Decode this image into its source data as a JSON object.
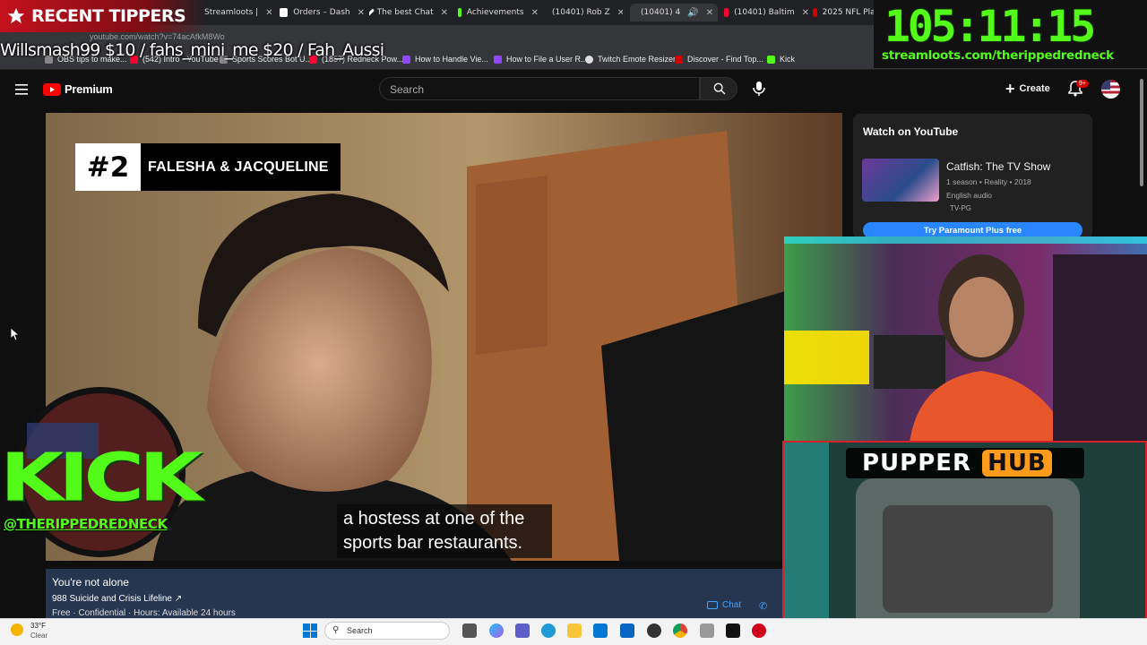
{
  "overlay": {
    "tippers_title": "RECENT TIPPERS",
    "tippers_scroll": "Willsmash99 $10 / fahs_mini_me $20 / Fah_Aussi",
    "timer": "105:11:15",
    "timer_url": "streamloots.com/therippedredneck",
    "kick_word": "KICK",
    "kick_handle": "@THERIPPEDREDNECK",
    "pupper_word": "PUPPER",
    "pupper_hub": "HUB"
  },
  "browser": {
    "tabs": [
      {
        "label": "Streamloots |",
        "color": "#ffffff"
      },
      {
        "label": "Orders – Dash",
        "color": "#ffffff"
      },
      {
        "label": "The best Chat",
        "color": "#ffffff"
      },
      {
        "label": "Achievements",
        "color": "#53fc18"
      },
      {
        "label": "(10401) Rob Z",
        "color": "#ff0033"
      },
      {
        "label": "(10401) 4",
        "color": "#ff0033"
      },
      {
        "label": "(10401) Baltim",
        "color": "#ff0033"
      },
      {
        "label": "2025 NFL Play",
        "color": "#d00000"
      }
    ],
    "url": "youtube.com/watch?v=74acAfkM8Wo",
    "bookmarks": [
      {
        "label": "OBS tips to make...",
        "color": "#888888"
      },
      {
        "label": "(542) Intro - YouTube",
        "color": "#ff0033"
      },
      {
        "label": "Sports Scores Bot U...",
        "color": "#888888"
      },
      {
        "label": "(1857) Redneck Pow...",
        "color": "#ff0033"
      },
      {
        "label": "How to Handle Vie...",
        "color": "#9146ff"
      },
      {
        "label": "How to File a User R...",
        "color": "#9146ff"
      },
      {
        "label": "Twitch Emote Resizer",
        "color": "#dddddd"
      },
      {
        "label": "Discover - Find Top...",
        "color": "#d00000"
      },
      {
        "label": "Kick",
        "color": "#53fc18"
      }
    ]
  },
  "youtube": {
    "brand": "Premium",
    "search_placeholder": "Search",
    "create_label": "Create",
    "notif_count": "9+",
    "video": {
      "rank": "#2",
      "rank_names": "FALESHA & JACQUELINE",
      "caption_line1": "a hostess at one of the",
      "caption_line2": "sports bar restaurants."
    },
    "crisis": {
      "title": "You're not alone",
      "line": "988 Suicide and Crisis Lifeline ↗",
      "sub": "Free · Confidential · Hours: Available 24 hours",
      "chat": "Chat"
    },
    "side": {
      "heading": "Watch on YouTube",
      "show_title": "Catfish: The TV Show",
      "show_meta": "1 season • Reality • 2018",
      "show_audio": "English audio",
      "show_rating": "TV-PG",
      "try_button": "Try Paramount Plus free"
    }
  },
  "taskbar": {
    "weather_temp": "33°F",
    "weather_cond": "Clear",
    "search_label": "Search"
  }
}
